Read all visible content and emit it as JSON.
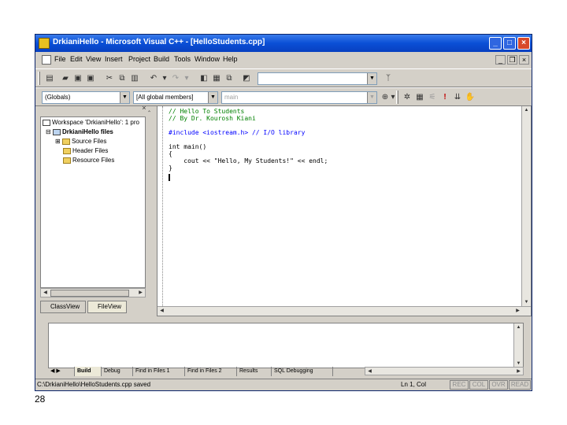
{
  "window": {
    "title": "DrkianiHello - Microsoft Visual C++ - [HelloStudents.cpp]",
    "caption_buttons": {
      "minimize": "_",
      "maximize": "□",
      "close": "×"
    }
  },
  "menu": {
    "items": [
      "File",
      "Edit",
      "View",
      "Insert",
      "Project",
      "Build",
      "Tools",
      "Window",
      "Help"
    ],
    "mdi_buttons": {
      "minimize": "_",
      "restore": "❐",
      "close": "×"
    }
  },
  "toolbar2": {
    "scope_combo": "(Globals)",
    "members_combo": "[All global members]",
    "function_combo": "main"
  },
  "workspace": {
    "close_glyph": "× ‸",
    "tree": [
      {
        "label": "Workspace 'DrkianiHello': 1 pro",
        "icon": "workspace-icon"
      },
      {
        "label": "DrkianiHello files",
        "icon": "project-icon"
      },
      {
        "label": "Source Files",
        "icon": "folder-icon"
      },
      {
        "label": "Header Files",
        "icon": "folder-icon"
      },
      {
        "label": "Resource Files",
        "icon": "folder-icon"
      }
    ],
    "tabs": [
      "ClassView",
      "FileView"
    ]
  },
  "editor": {
    "lines": [
      {
        "text": "// Hello To Students",
        "kind": "comment"
      },
      {
        "text": "// By Dr. Kourosh Kiani",
        "kind": "comment"
      },
      {
        "text": "",
        "kind": "plain"
      },
      {
        "text": "#include <iostream.h> // I/O library",
        "kind": "preproc"
      },
      {
        "text": "",
        "kind": "plain"
      },
      {
        "text": "int main()",
        "kind": "plain"
      },
      {
        "text": "{",
        "kind": "plain"
      },
      {
        "text": "    cout << \"Hello, My Students!\" << endl;",
        "kind": "plain"
      },
      {
        "text": "}",
        "kind": "plain"
      }
    ]
  },
  "output": {
    "tabs": [
      "Build",
      "Debug",
      "Find in Files 1",
      "Find in Files 2",
      "Results",
      "SQL Debugging"
    ]
  },
  "status": {
    "message": "C:\\DrkianiHello\\HelloStudents.cpp saved",
    "position": "Ln 1, Col",
    "indicators": [
      "REC",
      "COL",
      "OVR",
      "READ"
    ]
  },
  "slide_number": "28"
}
